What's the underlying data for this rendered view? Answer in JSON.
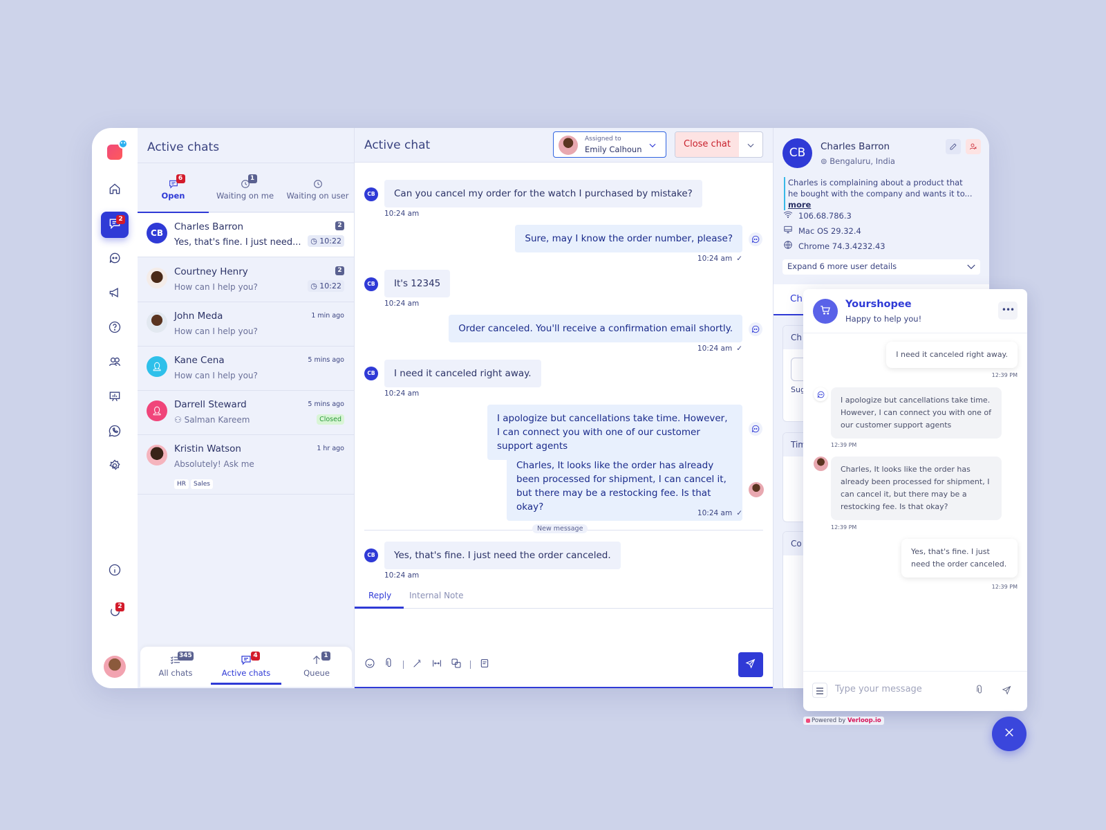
{
  "rail": {
    "items": [
      {
        "icon": "home-icon"
      },
      {
        "icon": "chats-icon",
        "badge": "2",
        "active": true
      },
      {
        "icon": "bot-icon"
      },
      {
        "icon": "megaphone-icon"
      },
      {
        "icon": "help-icon"
      },
      {
        "icon": "users-icon"
      },
      {
        "icon": "analytics-icon"
      },
      {
        "icon": "whatsapp-icon"
      },
      {
        "icon": "settings-icon"
      },
      {
        "icon": "info-icon"
      },
      {
        "icon": "status-icon",
        "badge": "2"
      }
    ],
    "logo_badge": "••"
  },
  "chat_list": {
    "title": "Active chats",
    "tabs": [
      {
        "label": "Open",
        "badge": "6",
        "active": true
      },
      {
        "label": "Waiting on me",
        "badge": "1"
      },
      {
        "label": "Waiting on user"
      }
    ],
    "rows": [
      {
        "initials": "CB",
        "name": "Charles Barron",
        "preview": "Yes, that's fine. I just need...",
        "count": "2",
        "time": "10:22",
        "selected": true
      },
      {
        "name": "Courtney Henry",
        "preview": "How can I help you?",
        "count": "2",
        "time": "10:22"
      },
      {
        "name": "John Meda",
        "preview": "How can I help you?",
        "ago": "1 min ago"
      },
      {
        "name": "Kane Cena",
        "preview": "How can I help you?",
        "ago": "5 mins ago"
      },
      {
        "name": "Darrell Steward",
        "preview": "Salman Kareem",
        "ago": "5 mins ago",
        "status": "Closed"
      },
      {
        "name": "Kristin Watson",
        "preview": "Absolutely! Ask me",
        "ago": "1 hr ago",
        "tags": [
          "HR",
          "Sales"
        ]
      }
    ],
    "bottom_tabs": [
      {
        "label": "All chats",
        "badge": "345"
      },
      {
        "label": "Active chats",
        "badge": "4",
        "active": true
      },
      {
        "label": "Queue",
        "badge": "1"
      }
    ]
  },
  "active_chat": {
    "title": "Active chat",
    "assigned_label": "Assigned to",
    "assigned_name": "Emily Calhoun",
    "close_label": "Close chat",
    "messages": [
      {
        "from": "user",
        "initials": "CB",
        "text": "Can you cancel my order for the watch I purchased by mistake?",
        "time": "10:24 am"
      },
      {
        "from": "bot",
        "text": "Sure, may I know the order number, please?",
        "time": "10:24 am"
      },
      {
        "from": "user",
        "initials": "CB",
        "text": "It's 12345",
        "time": "10:24 am"
      },
      {
        "from": "bot",
        "text": "Order canceled. You'll receive a confirmation email shortly.",
        "time": "10:24 am"
      },
      {
        "from": "user",
        "initials": "CB",
        "text": "I need it canceled right away.",
        "time": "10:24 am"
      },
      {
        "from": "bot",
        "text": "I apologize but cancellations take time. However, I can connect you with one of our customer support agents"
      },
      {
        "from": "agent",
        "text": "Charles, It looks like the order has already been processed for shipment, I can cancel it, but there may be a restocking fee. Is that okay?",
        "time": "10:24 am"
      },
      {
        "from": "user",
        "initials": "CB",
        "text": "Yes, that's fine. I just need the order canceled.",
        "time": "10:24 am"
      }
    ],
    "new_message_label": "New message",
    "reply_tabs": [
      "Reply",
      "Internal Note"
    ],
    "toolbar": [
      "emoji-icon",
      "attach-icon",
      "magic-icon",
      "expand-icon",
      "translate-icon",
      "template-icon"
    ]
  },
  "profile": {
    "initials": "CB",
    "name": "Charles Barron",
    "location": "Bengaluru, India",
    "description": "Charles is complaining about a product that he bought with the company and wants it to...",
    "more": "more",
    "ip": "106.68.786.3",
    "os": "Mac OS 29.32.4",
    "browser": "Chrome 74.3.4232.43",
    "expand_label": "Expand 6 more user details",
    "tab_label": "Ch",
    "cards": [
      "Ch",
      "Tim",
      "Co"
    ],
    "card_sub": "Sug"
  },
  "widget": {
    "name": "Yourshopee",
    "subtitle": "Happy to help you!",
    "messages": [
      {
        "from": "user",
        "text": "I need it canceled right away.",
        "time": "12:39 PM"
      },
      {
        "from": "bot",
        "text": "I apologize but cancellations take time. However, I can connect you with one of our customer support agents",
        "time": "12:39 PM"
      },
      {
        "from": "agent",
        "text": "Charles, It looks like the order has already been processed for shipment, I can cancel it, but there may be a restocking fee. Is that okay?",
        "time": "12:39 PM"
      },
      {
        "from": "user",
        "text": "Yes, that's fine. I just need the order canceled.",
        "time": "12:39 PM"
      }
    ],
    "input_placeholder": "Type your message",
    "powered_prefix": "Powered by",
    "powered_brand": "Verloop.io"
  },
  "colors": {
    "accent": "#2f3ad6",
    "danger": "#c8202c",
    "badge": "#d31b2b",
    "closed": "#2b9a3a"
  }
}
